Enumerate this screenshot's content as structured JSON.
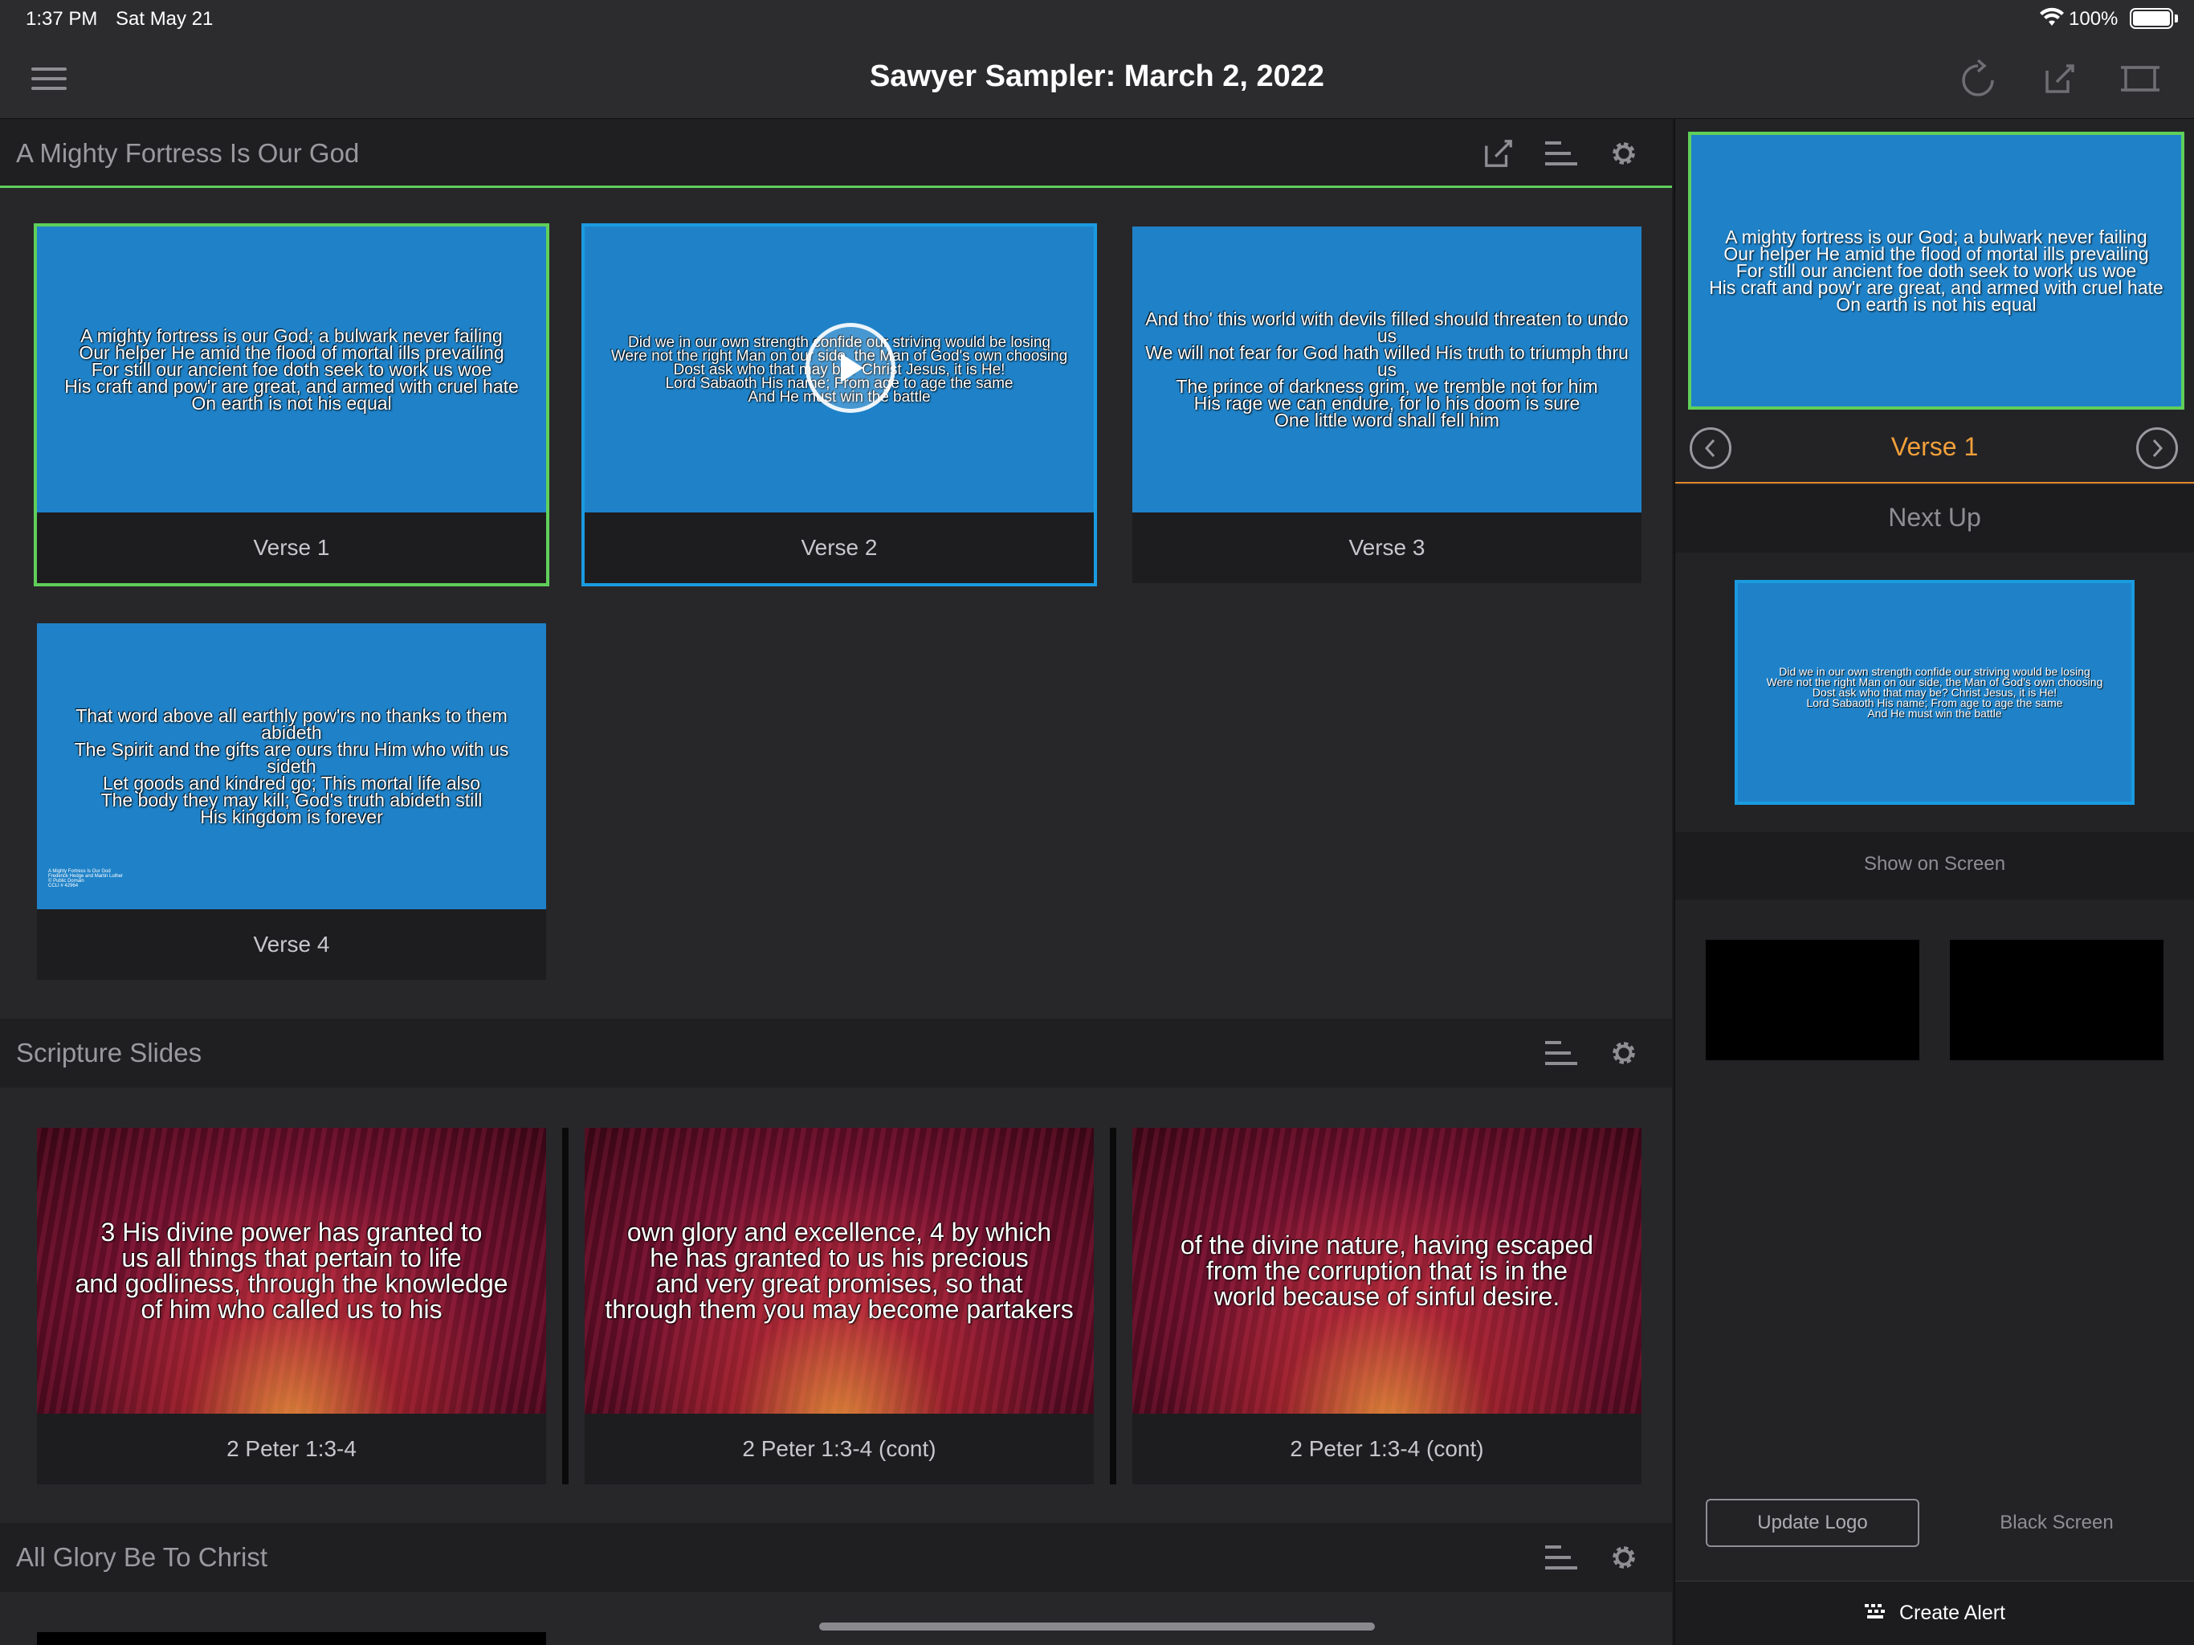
{
  "status_bar": {
    "time": "1:37 PM",
    "date": "Sat May 21",
    "battery_percent": "100%",
    "battery_level": 1.0
  },
  "header": {
    "title": "Sawyer Sampler: March 2, 2022",
    "icons": [
      "menu-icon",
      "refresh-icon",
      "edit-icon",
      "screen-icon"
    ]
  },
  "sections": [
    {
      "name": "A Mighty Fortress Is Our God",
      "icons": [
        "edit-icon",
        "arrange-icon",
        "gear-icon"
      ],
      "slides": [
        {
          "caption": "Verse 1",
          "text": "A mighty fortress is our God; a bulwark never failing\nOur helper He amid the flood of mortal ills prevailing\nFor still our ancient foe doth seek to work us woe\nHis craft and pow'r are great, and armed with cruel hate\nOn earth is not his equal",
          "state": "live"
        },
        {
          "caption": "Verse 2",
          "text": "Did we in our own strength confide our striving would be losing\nWere not the right Man on our side, the Man of God's own choosing\nDost ask who that may be? Christ Jesus, it is He!\nLord Sabaoth His name; From age to age the same\nAnd He must win the battle",
          "state": "queued"
        },
        {
          "caption": "Verse 3",
          "text": "And tho' this world with devils filled should threaten to undo us\nWe will not fear for God hath willed His truth to triumph thru us\nThe prince of darkness grim, we tremble not for him\nHis rage we can endure, for lo his doom is sure\nOne little word shall fell him",
          "state": "none"
        },
        {
          "caption": "Verse 4",
          "text": "That word above all earthly pow'rs no thanks to them abideth\nThe Spirit and the gifts are ours thru Him who with us sideth\nLet goods and kindred go; This mortal life also\nThe body they may kill; God's truth abideth still\nHis kingdom is forever",
          "state": "none",
          "credit": "A Mighty Fortress Is Our God\nFrederick Hedge and Martin Luther\n© Public Domain\nCCLI # 42964"
        }
      ]
    },
    {
      "name": "Scripture Slides",
      "icons": [
        "arrange-icon",
        "gear-icon"
      ],
      "slides": [
        {
          "caption": "2 Peter 1:3-4",
          "text": "3 His divine power has granted to\nus all things that pertain to life\nand godliness, through the knowledge\nof him who called us to his"
        },
        {
          "caption": "2 Peter 1:3-4 (cont)",
          "text": "own glory and excellence, 4 by which\nhe has granted to us his precious\nand very great promises, so that\nthrough them you may become partakers"
        },
        {
          "caption": "2 Peter 1:3-4 (cont)",
          "text": "of the divine nature, having escaped\nfrom the corruption that is in the\nworld because of sinful desire."
        }
      ]
    },
    {
      "name": "All Glory Be To Christ",
      "icons": [
        "arrange-icon",
        "gear-icon"
      ]
    }
  ],
  "sidebar": {
    "preview_text": "A mighty fortress is our God; a bulwark never failing\nOur helper He amid the flood of mortal ills prevailing\nFor still our ancient foe doth seek to work us woe\nHis craft and pow'r are great, and armed with cruel hate\nOn earth is not his equal",
    "current_label": "Verse 1",
    "next_up_label": "Next Up",
    "next_preview_text": "Did we in our own strength confide our striving would be losing\nWere not the right Man on our side, the Man of God's own choosing\nDost ask who that may be? Christ Jesus, it is He!\nLord Sabaoth His name; From age to age the same\nAnd He must win the battle",
    "show_on_screen_label": "Show on Screen",
    "update_logo_label": "Update Logo",
    "black_screen_label": "Black Screen",
    "create_alert_label": "Create Alert"
  },
  "colors": {
    "live": "#5fcf5a",
    "queued": "#1a9be0",
    "accent": "#f2a03a",
    "slide_blue": "#1f82c8"
  }
}
